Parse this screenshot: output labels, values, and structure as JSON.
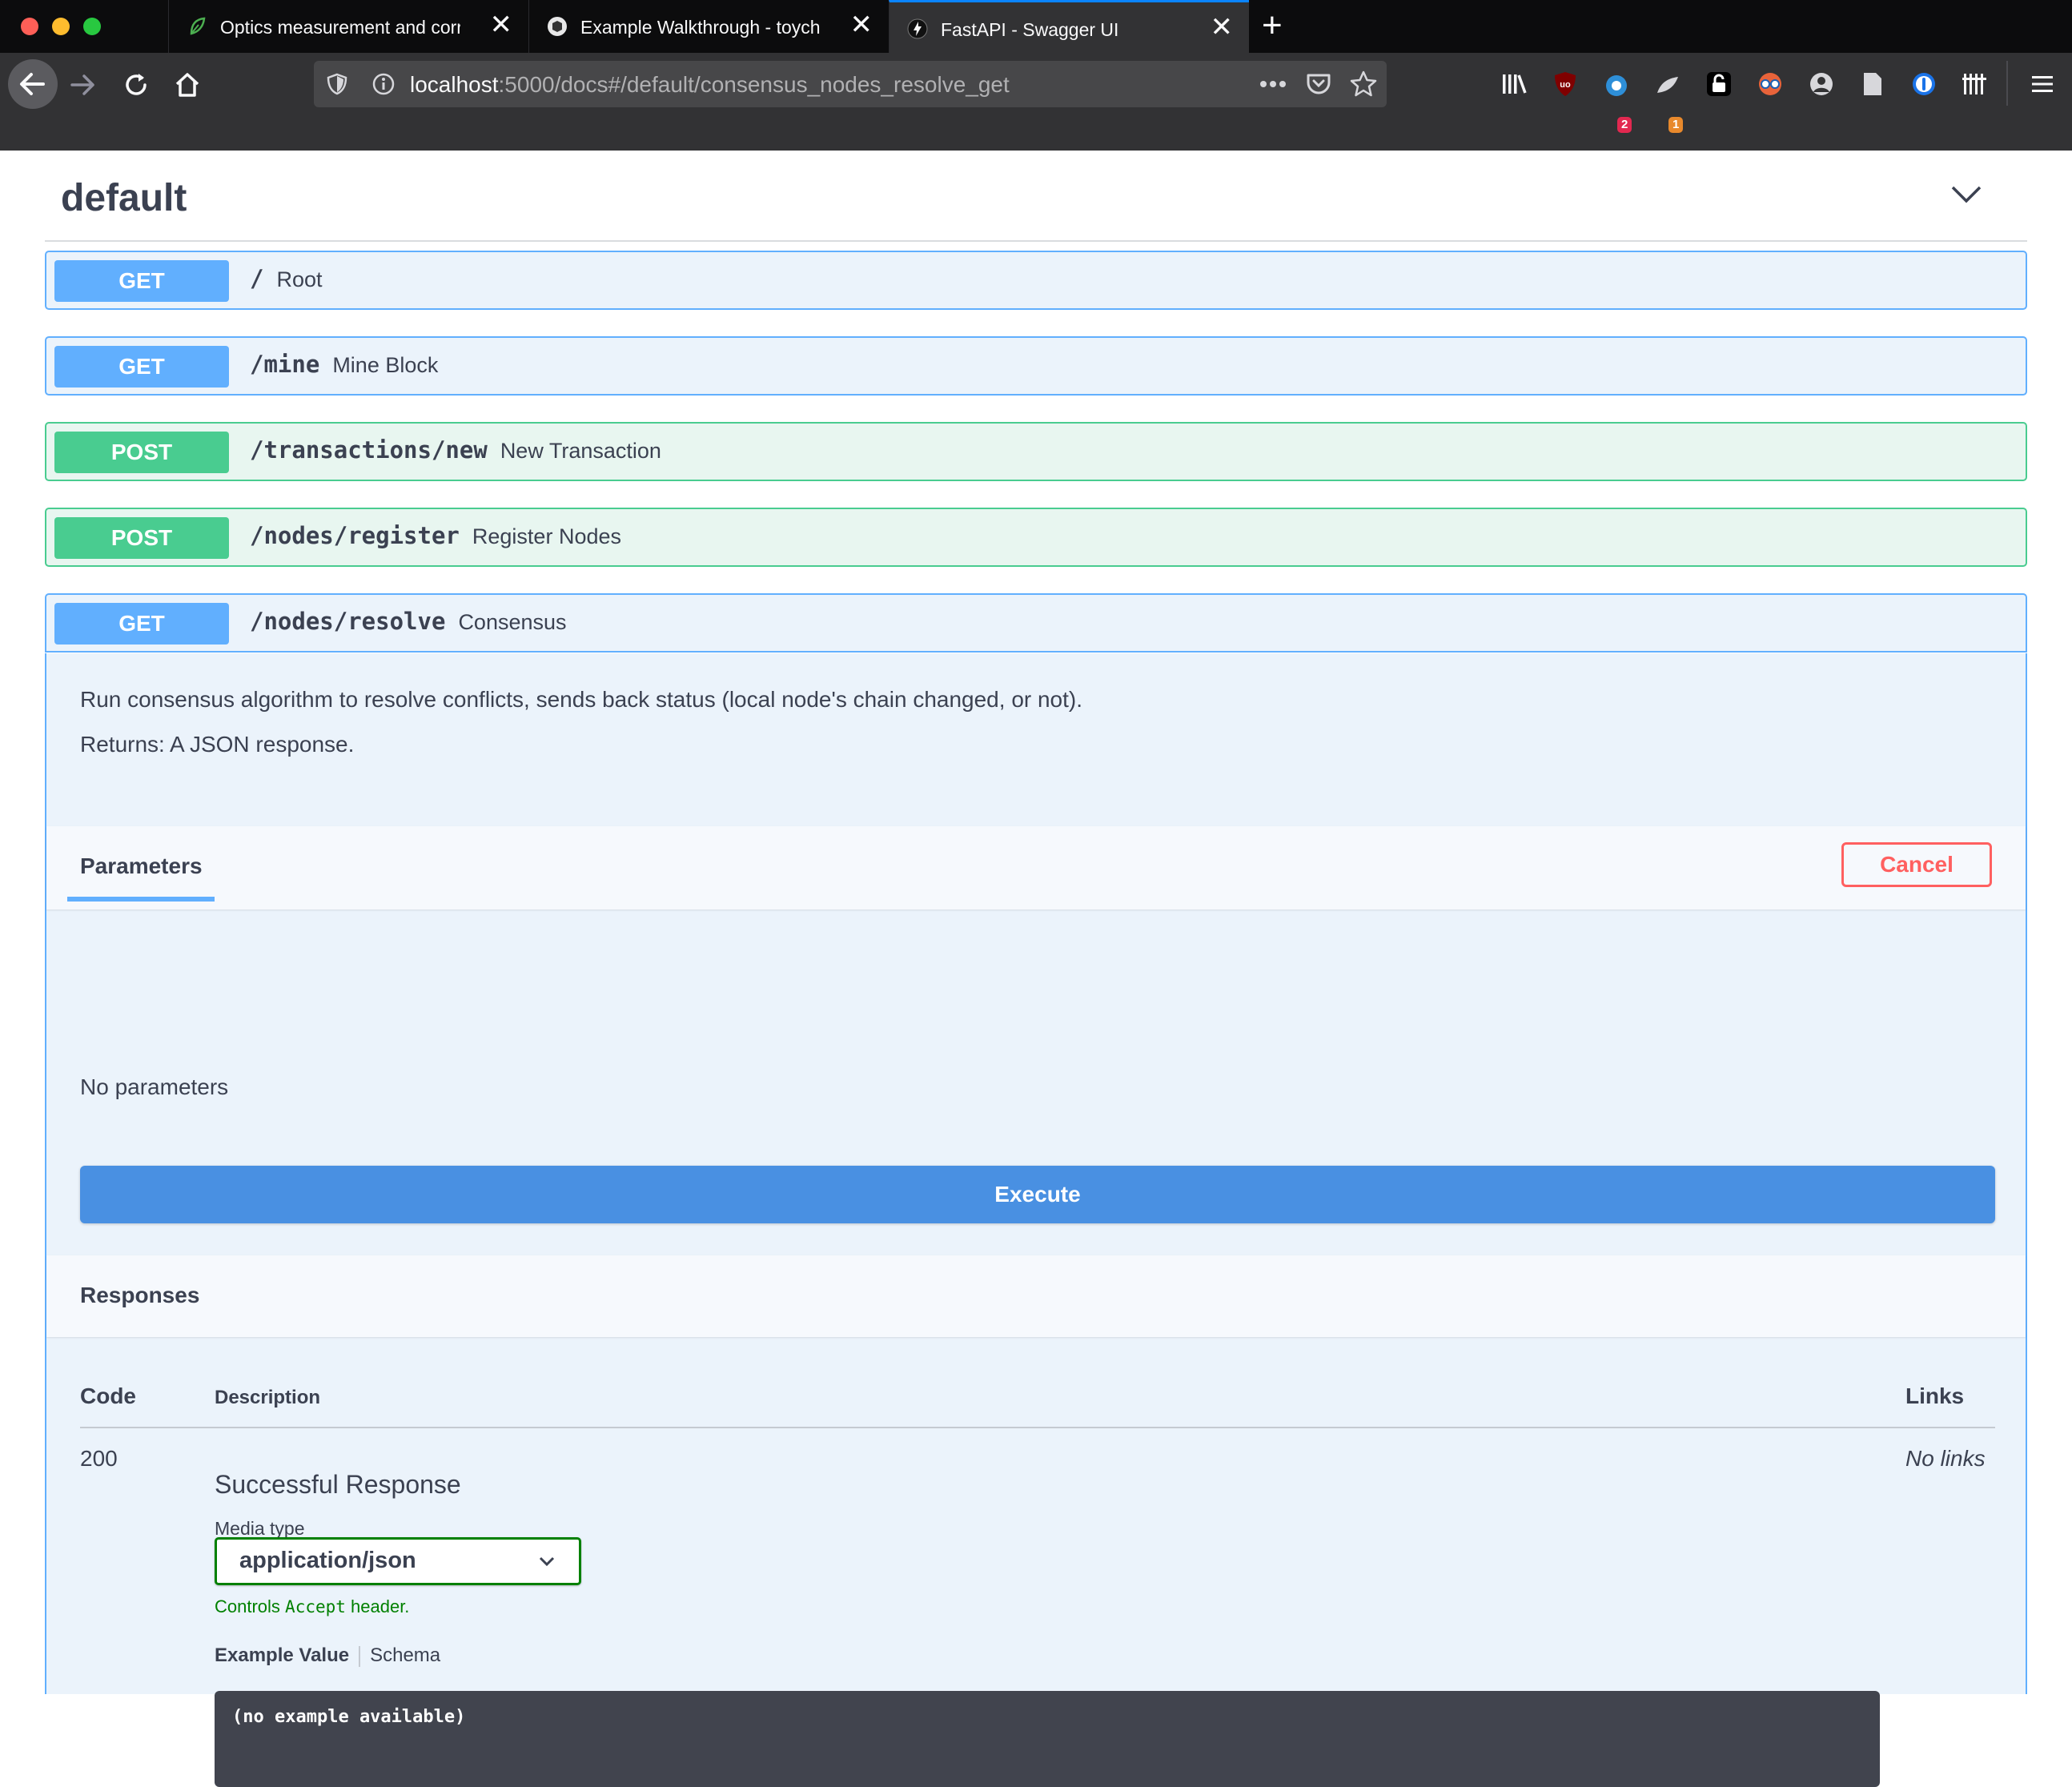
{
  "browser": {
    "tabs": [
      {
        "title": "Optics measurement and correc",
        "active": false
      },
      {
        "title": "Example Walkthrough - toychain",
        "active": false
      },
      {
        "title": "FastAPI - Swagger UI",
        "active": true
      }
    ],
    "url": {
      "host": "localhost",
      "rest": ":5000/docs#/default/consensus_nodes_resolve_get"
    },
    "badges": {
      "ext1": "2",
      "ext2": "1"
    }
  },
  "section": {
    "title": "default"
  },
  "operations": [
    {
      "method": "GET",
      "path": "/",
      "summary": "Root"
    },
    {
      "method": "GET",
      "path": "/mine",
      "summary": "Mine Block"
    },
    {
      "method": "POST",
      "path": "/transactions/new",
      "summary": "New Transaction"
    },
    {
      "method": "POST",
      "path": "/nodes/register",
      "summary": "Register Nodes"
    },
    {
      "method": "GET",
      "path": "/nodes/resolve",
      "summary": "Consensus"
    }
  ],
  "expanded": {
    "description": "Run consensus algorithm to resolve conflicts, sends back status (local node's chain changed, or not).",
    "returns": "Returns: A JSON response.",
    "parameters_label": "Parameters",
    "cancel_label": "Cancel",
    "no_params": "No parameters",
    "execute_label": "Execute",
    "responses_label": "Responses",
    "table": {
      "code_header": "Code",
      "desc_header": "Description",
      "links_header": "Links",
      "rows": [
        {
          "code": "200",
          "description": "Successful Response",
          "links": "No links"
        }
      ]
    },
    "media_type_label": "Media type",
    "media_type_value": "application/json",
    "accept_note": {
      "pre": "Controls ",
      "mono": "Accept",
      "post": " header."
    },
    "example_tab": "Example Value",
    "schema_tab": "Schema",
    "example_code": "(no example available)"
  }
}
